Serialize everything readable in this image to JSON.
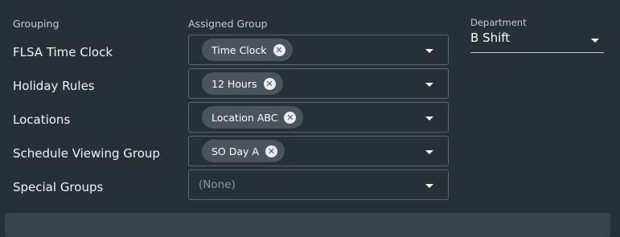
{
  "headers": {
    "grouping": "Grouping",
    "assigned_group": "Assigned Group"
  },
  "department": {
    "label": "Department",
    "value": "B Shift"
  },
  "rows": [
    {
      "label": "FLSA Time Clock",
      "chip": "Time Clock"
    },
    {
      "label": "Holiday Rules",
      "chip": "12 Hours"
    },
    {
      "label": "Locations",
      "chip": "Location ABC"
    },
    {
      "label": "Schedule Viewing Group",
      "chip": "SO Day A"
    },
    {
      "label": "Special Groups",
      "placeholder": "(None)"
    }
  ],
  "icons": {
    "remove": "close-circle-icon",
    "dropdown": "caret-down-icon"
  },
  "colors": {
    "background": "#272f37",
    "chip": "#4b545d",
    "border": "#5c666f"
  }
}
